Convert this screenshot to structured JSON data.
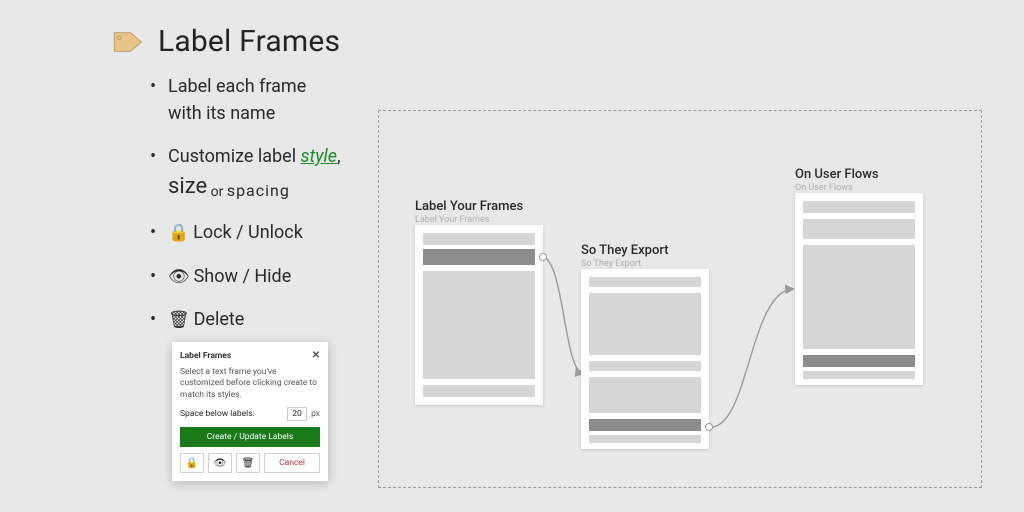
{
  "header": {
    "title": "Label Frames"
  },
  "bullets": {
    "b1_line1": "Label each frame",
    "b1_line2": "with its name",
    "b2_prefix": "Customize label ",
    "b2_style": "style",
    "b2_comma": ",",
    "b2_size": "size",
    "b2_or": " or ",
    "b2_spacing": "spacing",
    "b3": "Lock / Unlock",
    "b4": "Show / Hide",
    "b5": "Delete"
  },
  "dialog": {
    "title": "Label Frames",
    "help": "Select a text frame you've customized before clicking create to match its styles.",
    "space_label": "Space below labels:",
    "space_value": "20",
    "space_unit": "px",
    "create_btn": "Create / Update Labels",
    "cancel": "Cancel"
  },
  "frames": {
    "f1_label": "Label Your Frames",
    "f1_sub": "Label Your Frames",
    "f2_label": "So They Export",
    "f2_sub": "So They Export",
    "f3_label": "On User Flows",
    "f3_sub": "On User Flows"
  }
}
